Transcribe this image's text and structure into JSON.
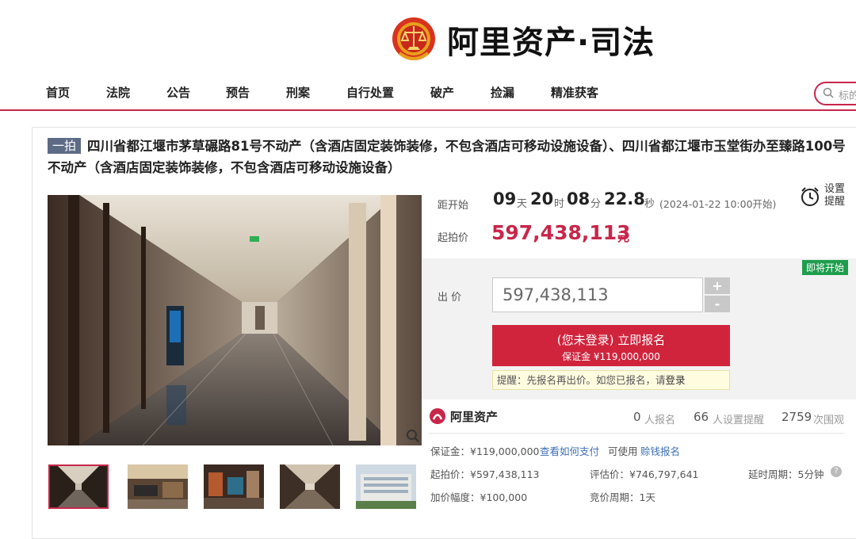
{
  "brand": {
    "name": "阿里资产·司法",
    "emblem_icon": "court-emblem-icon"
  },
  "nav": {
    "items": [
      "首页",
      "法院",
      "公告",
      "预告",
      "刑案",
      "自行处置",
      "破产",
      "捡漏",
      "精准获客"
    ]
  },
  "search": {
    "placeholder": "标的"
  },
  "lot": {
    "badge": "一拍",
    "title": "四川省都江堰市茅草碾路81号不动产（含酒店固定装饰装修，不包含酒店可移动设施设备）、四川省都江堰市玉堂街办至臻路100号不动产（含酒店固定装饰装修，不包含酒店可移动设施设备）"
  },
  "countdown": {
    "label": "距开始",
    "days": "09",
    "days_unit": "天",
    "hours": "20",
    "hours_unit": "时",
    "minutes": "08",
    "minutes_unit": "分",
    "seconds": "22.8",
    "seconds_unit": "秒",
    "start": "(2024-01-22 10:00开始)"
  },
  "remind": {
    "label": "设置提醒"
  },
  "start_price": {
    "label": "起拍价",
    "value": "597,438,113",
    "unit": "元"
  },
  "status_tag": "即将开始",
  "bid": {
    "label": "出 价",
    "value": "597,438,113",
    "plus": "+",
    "minus": "-"
  },
  "signup": {
    "label": "(您未登录) 立即报名",
    "deposit": "保证金 ¥119,000,000"
  },
  "notice": {
    "text": "提醒：先报名再出价。如您已报名，请",
    "link": "登录"
  },
  "platform": {
    "name": "阿里资产"
  },
  "stats": {
    "signed": "0",
    "signed_label": "人报名",
    "reminders": "66",
    "reminders_label": "人设置提醒",
    "views": "2759",
    "views_label": "次围观"
  },
  "details": {
    "deposit": "保证金：¥119,000,000",
    "how_to_pay": "查看如何支付",
    "usable": "可使用",
    "credit_signup": "赊钱报名",
    "start_price": "起拍价：¥597,438,113",
    "appraisal": "评估价：¥746,797,641",
    "delay": "延时周期：5分钟",
    "increment": "加价幅度：¥100,000",
    "auction_period": "竞价周期：1天"
  },
  "colors": {
    "accent": "#c8264a",
    "status_green": "#1e9e4d",
    "link": "#3c6fb6"
  }
}
